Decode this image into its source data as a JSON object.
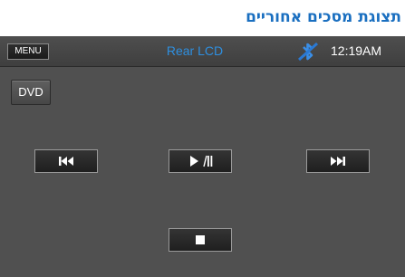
{
  "heading": "תצוגת מסכים אחוריים",
  "topbar": {
    "menu_label": "MENU",
    "title": "Rear LCD",
    "time": "12:19AM",
    "bluetooth_icon": "bluetooth-disabled-icon"
  },
  "source_button": {
    "label": "DVD"
  },
  "controls": {
    "prev_icon": "skip-previous-icon",
    "play_pause_icon": "play-pause-icon",
    "next_icon": "skip-next-icon",
    "stop_icon": "stop-icon"
  },
  "colors": {
    "heading": "#1a6fc0",
    "title": "#2e8fe0",
    "screen_bg": "#505050"
  }
}
